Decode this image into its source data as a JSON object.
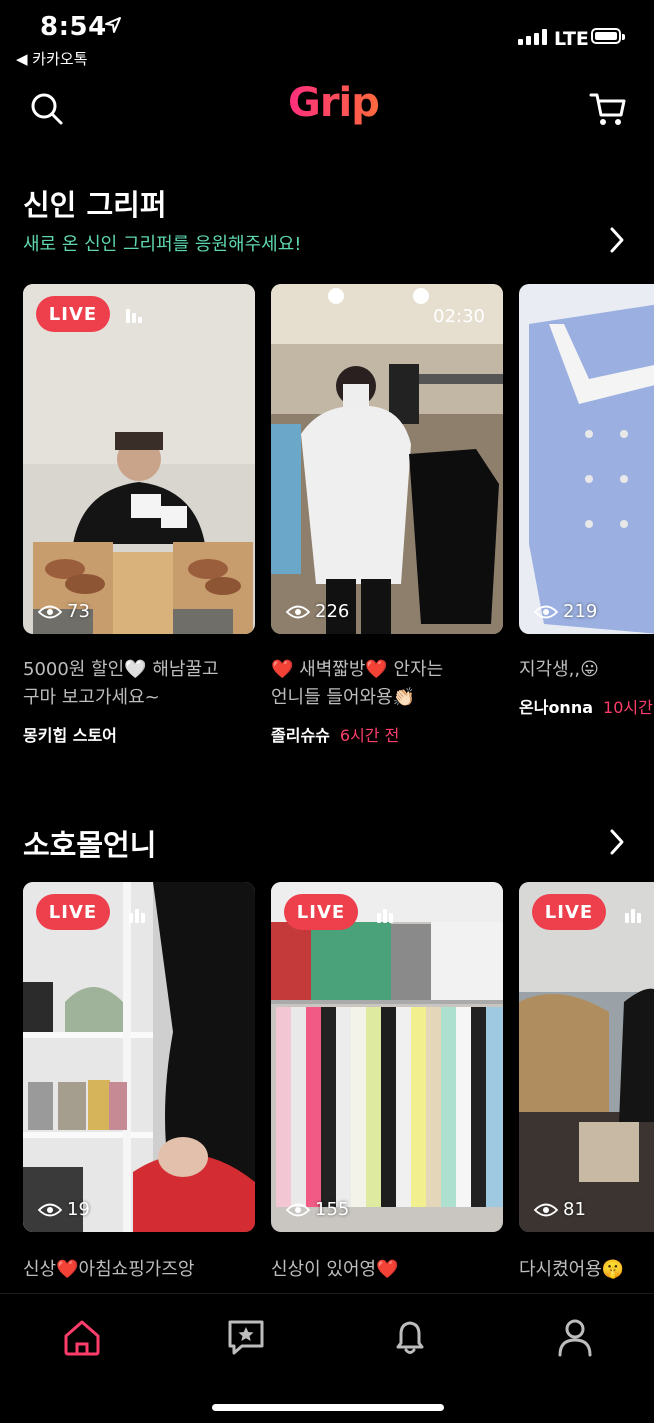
{
  "status_bar": {
    "time": "8:54",
    "back_app": "◀ 카카오톡",
    "network": "LTE"
  },
  "header": {
    "logo": "Grip",
    "search_icon": "search-icon",
    "cart_icon": "cart-icon"
  },
  "sections": [
    {
      "title": "신인 그리퍼",
      "subtitle": "새로 온 신인 그리퍼를 응원해주세요!",
      "cards": [
        {
          "live": "LIVE",
          "views": "73",
          "desc_line1": "5000원 할인🤍 해남꿀고",
          "desc_line2": "구마 보고가세요~",
          "store": "몽키힙 스토어",
          "ago": ""
        },
        {
          "duration": "02:30",
          "views": "226",
          "desc_line1": "❤️ 새벽짧방❤️ 안자는",
          "desc_line2": "언니들 들어와용👏🏻",
          "store": "졸리슈슈",
          "ago": "6시간 전"
        },
        {
          "views": "219",
          "desc_line1": "지각생,,😛",
          "store": "온나onna",
          "ago": "10시간"
        }
      ]
    },
    {
      "title": "소호몰언니",
      "cards": [
        {
          "live": "LIVE",
          "views": "19",
          "desc_line1": "신상❤️아침쇼핑가즈앙"
        },
        {
          "live": "LIVE",
          "views": "155",
          "desc_line1": "신상이 있어영❤️"
        },
        {
          "live": "LIVE",
          "views": "81",
          "desc_line1": "다시켰어용🤫"
        }
      ]
    }
  ],
  "tabs": [
    {
      "name": "home",
      "icon": "home-icon",
      "active": true
    },
    {
      "name": "favorites",
      "icon": "star-message-icon"
    },
    {
      "name": "notifications",
      "icon": "bell-icon"
    },
    {
      "name": "profile",
      "icon": "person-icon"
    }
  ],
  "colors": {
    "accent": "#ff3d6b",
    "live": "#ee3f4d",
    "subtitle": "#5ed6b0",
    "tab_active": "#ff3d6b"
  }
}
